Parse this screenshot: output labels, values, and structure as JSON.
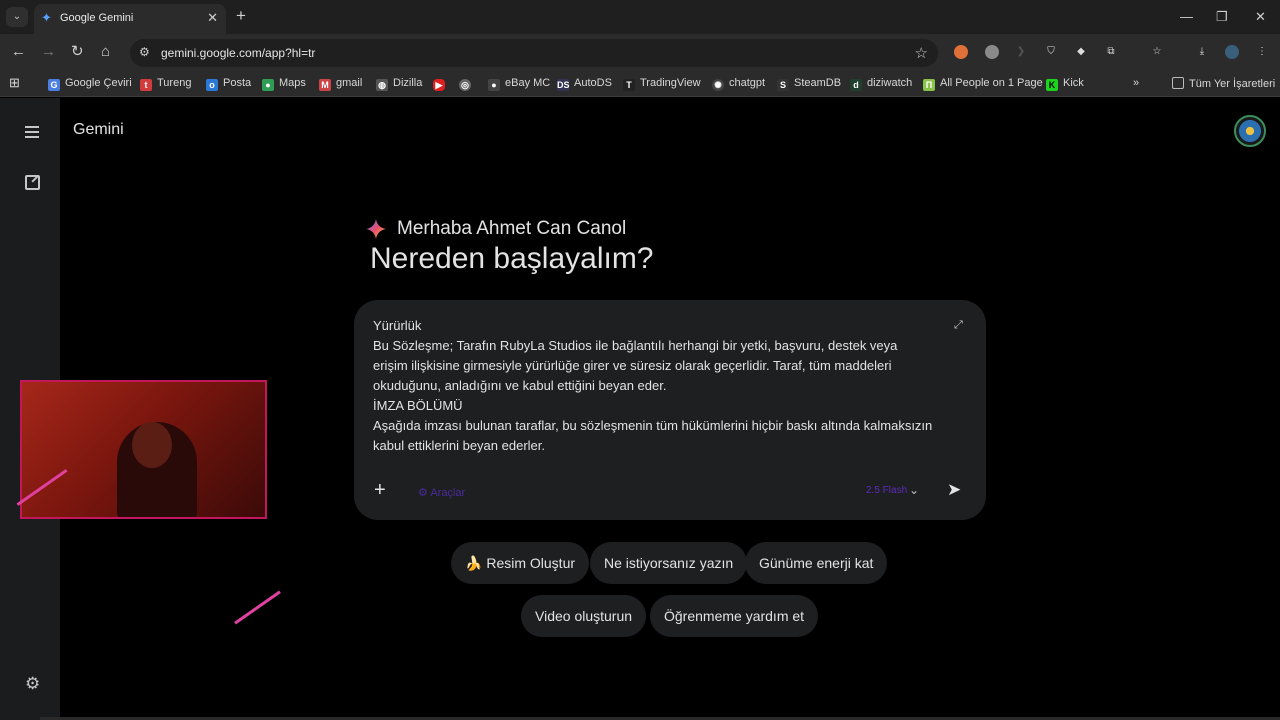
{
  "browser": {
    "tab": {
      "title": "Google Gemini"
    },
    "url": "gemini.google.com/app?hl=tr",
    "bookmarks": [
      "Google Çeviri",
      "Tureng",
      "Posta",
      "Maps",
      "gmail",
      "Dizilla",
      "eBay MC",
      "AutoDS",
      "TradingView",
      "chatgpt",
      "SteamDB",
      "diziwatch",
      "All People on 1 Page",
      "Kick"
    ],
    "all_bookmarks_label": "Tüm Yer İşaretleri"
  },
  "gemini": {
    "app_title": "Gemini",
    "greeting": "Merhaba Ahmet Can Canol",
    "headline": "Nereden başlayalım?",
    "prompt_lines": [
      "Yürürlük",
      "Bu Sözleşme; Tarafın RubyLa Studios ile bağlantılı herhangi bir yetki, başvuru, destek veya erişim ilişkisine girmesiyle yürürlüğe girer ve süresiz olarak geçerlidir. Taraf, tüm maddeleri okuduğunu, anladığını ve kabul ettiğini beyan eder.",
      "İMZA BÖLÜMÜ",
      "Aşağıda imzası bulunan taraflar, bu sözleşmenin tüm hükümlerini hiçbir baskı altında kalmaksızın kabul ettiklerini beyan ederler."
    ],
    "tools_label": "Araçlar",
    "model_label": "2.5 Flash",
    "suggestions": [
      {
        "icon": "🍌",
        "label": "Resim Oluştur"
      },
      {
        "label": "Ne istiyorsanız yazın"
      },
      {
        "label": "Günüme enerji kat"
      },
      {
        "label": "Video oluşturun"
      },
      {
        "label": "Öğrenmeme yardım et"
      }
    ]
  }
}
